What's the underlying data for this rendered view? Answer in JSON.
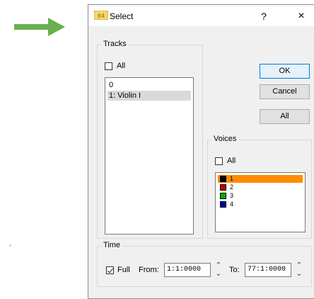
{
  "colors": {
    "arrow": "#6ab04c",
    "voice_selected": "#ff8c00"
  },
  "dialog": {
    "title": "Select",
    "app_icon": "app-icon",
    "help_label": "?",
    "close_label": "×"
  },
  "tracks": {
    "group_label": "Tracks",
    "all_label": "All",
    "all_checked": false,
    "items": [
      "0",
      "1: Violin I"
    ],
    "selected_index": 1
  },
  "buttons": {
    "ok": "OK",
    "cancel": "Cancel",
    "all": "All"
  },
  "voices": {
    "group_label": "Voices",
    "all_label": "All",
    "all_checked": false,
    "items": [
      {
        "label": "1",
        "color": "#000000"
      },
      {
        "label": "2",
        "color": "#c00000"
      },
      {
        "label": "3",
        "color": "#00b000"
      },
      {
        "label": "4",
        "color": "#0000b0"
      }
    ],
    "selected_index": 0
  },
  "time": {
    "group_label": "Time",
    "full_label": "Full",
    "full_checked": true,
    "from_label": "From:",
    "from_value": "1:1:0000",
    "to_label": "To:",
    "to_value": "77:1:0000"
  }
}
